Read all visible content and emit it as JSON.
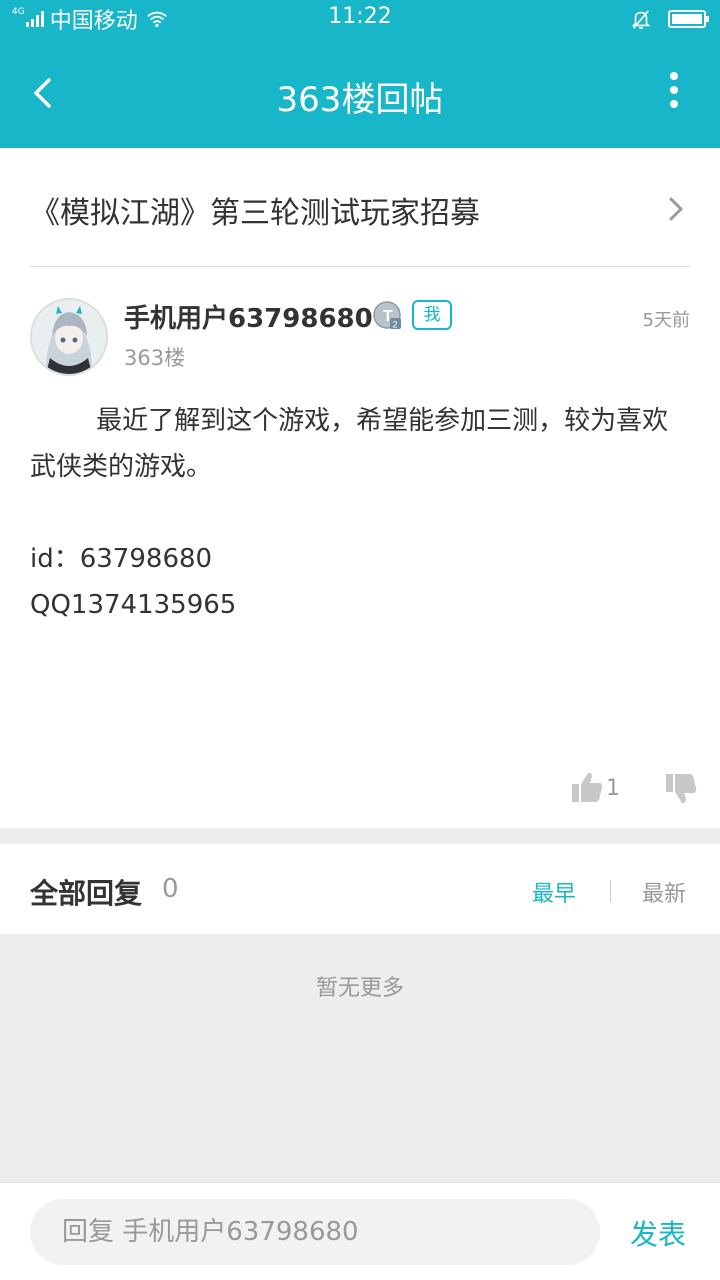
{
  "status_bar": {
    "network": "4G",
    "carrier": "中国移动",
    "time": "11:22"
  },
  "header": {
    "title": "363楼回帖"
  },
  "topic": {
    "title": "《模拟江湖》第三轮测试玩家招募"
  },
  "post": {
    "username": "手机用户63798680",
    "level_badge": "T2",
    "me_badge": "我",
    "floor": "363楼",
    "time_ago": "5天前",
    "content": "        最近了解到这个游戏，希望能参加三测，较为喜欢武侠类的游戏。\n\nid：63798680\nQQ1374135965",
    "like_count": "1"
  },
  "replies": {
    "title": "全部回复",
    "count": "0",
    "sort_earliest": "最早",
    "sort_latest": "最新",
    "empty_text": "暂无更多"
  },
  "bottom_bar": {
    "input_placeholder": "回复 手机用户63798680",
    "send_label": "发表"
  },
  "colors": {
    "accent": "#17b6c8",
    "background_gray": "#ededed"
  }
}
